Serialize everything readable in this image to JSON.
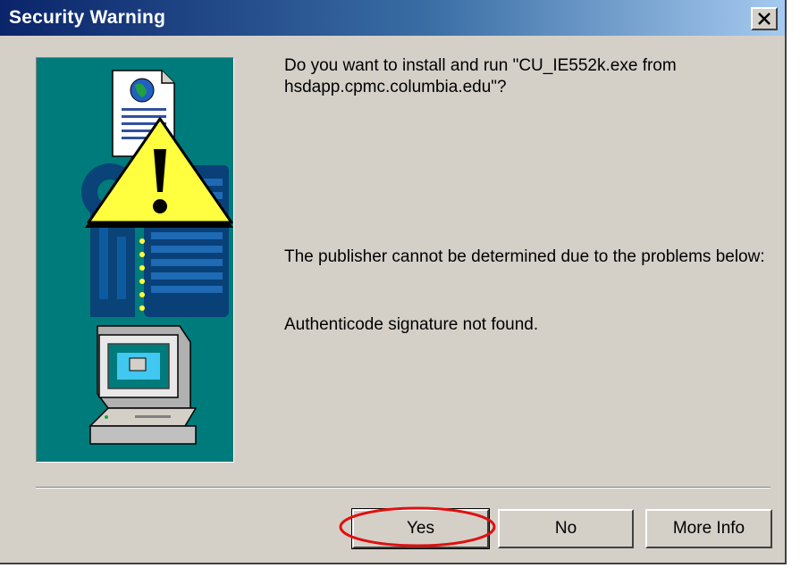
{
  "window": {
    "title": "Security Warning",
    "close_icon": "close-icon"
  },
  "message": {
    "question": "Do you want to install and run \"CU_IE552k.exe from hsdapp.cpmc.columbia.edu\"?",
    "publisher_note": "The publisher cannot be determined due to the problems below:",
    "signature_note": "Authenticode signature not found."
  },
  "illustration": {
    "icons": [
      "document-globe-icon",
      "warning-icon",
      "keys-icon",
      "computer-icon"
    ],
    "background": "#007b7b"
  },
  "buttons": {
    "yes": "Yes",
    "no": "No",
    "more_info": "More Info"
  },
  "annotation": {
    "highlight_color": "#e01010",
    "highlight_target": "yes-button"
  },
  "colors": {
    "dialog_bg": "#d4d0c8",
    "titlebar_start": "#0a246a",
    "titlebar_end": "#a6caf0"
  }
}
